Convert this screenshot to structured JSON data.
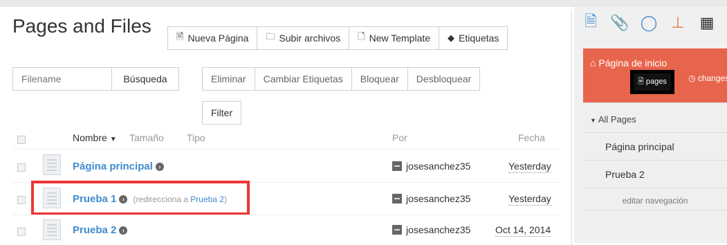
{
  "page": {
    "title": "Pages and Files"
  },
  "toolbar": {
    "new_page": "Nueva Página",
    "upload": "Subir archivos",
    "new_template": "New Template",
    "tags": "Etiquetas"
  },
  "search": {
    "placeholder": "Filename",
    "button": "Búsqueda"
  },
  "actions": {
    "delete": "Eliminar",
    "change_tags": "Cambiar Etiquetas",
    "lock": "Bloquear",
    "unlock": "Desbloquear",
    "filter": "Filter"
  },
  "columns": {
    "name": "Nombre",
    "size": "Tamaño",
    "type": "Tipo",
    "by": "Por",
    "date": "Fecha"
  },
  "rows": [
    {
      "name": "Página principal",
      "redirect_prefix": "",
      "redirect_target": "",
      "user": "josesanchez35",
      "date": "Yesterday"
    },
    {
      "name": "Prueba 1",
      "redirect_prefix": "(redirecciona a",
      "redirect_target": "Prueba 2",
      "redirect_suffix": ")",
      "user": "josesanchez35",
      "date": "Yesterday"
    },
    {
      "name": "Prueba 2",
      "redirect_prefix": "",
      "redirect_target": "",
      "user": "josesanchez35",
      "date": "Oct 14, 2014"
    }
  ],
  "sidebar": {
    "home_title": "Página de inicio",
    "pages_badge": "pages",
    "changes": "changes",
    "all_pages": "All Pages",
    "items": [
      "Página principal",
      "Prueba 2"
    ],
    "edit_nav": "editar navegación"
  },
  "icons": [
    "document-icon",
    "paperclip-icon",
    "comment-icon",
    "sitemap-icon",
    "calendar-icon"
  ],
  "colors": {
    "accent": "#3f8ccf",
    "home_box": "#e8654d",
    "highlight": "#ef3434"
  }
}
